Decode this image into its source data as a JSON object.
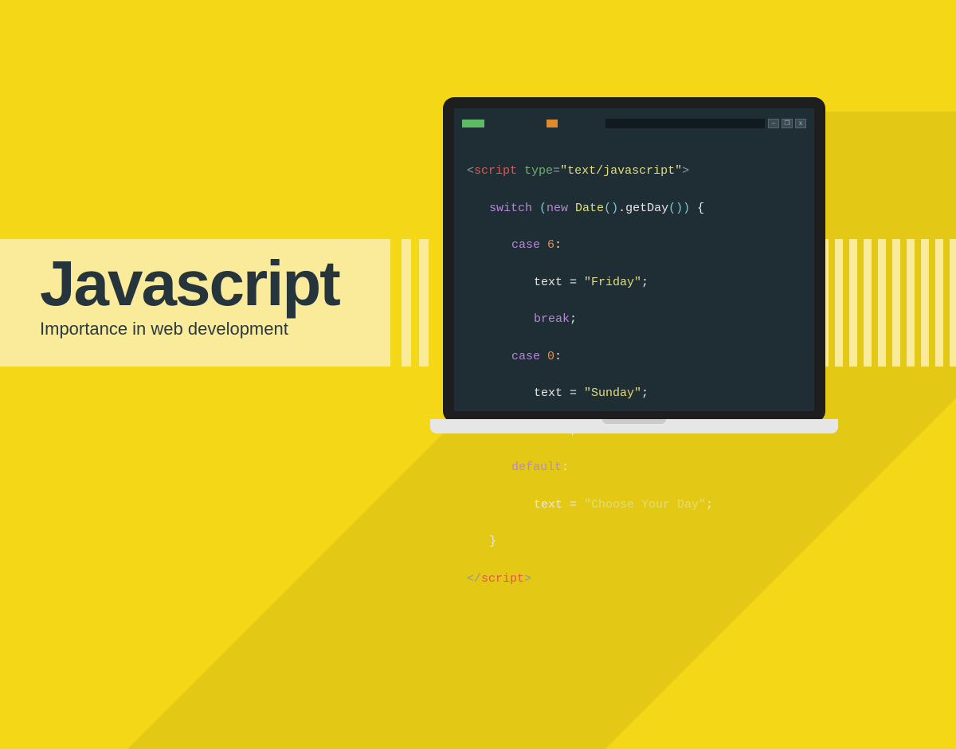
{
  "title": "Javascript",
  "subtitle": "Importance in web development",
  "window_icons": {
    "min": "–",
    "max": "❐",
    "close": "x"
  },
  "code": {
    "open_tag_l": "<",
    "open_tag_name": "script",
    "attr_name": " type",
    "eq": "=",
    "attr_val": "\"text/javascript\"",
    "open_tag_r": ">",
    "kw_switch": "switch ",
    "pl": "(",
    "kw_new": "new ",
    "cls_date": "Date",
    "pl2": "()",
    "dot": ".",
    "m_getday": "getDay",
    "pl3": "()",
    "pr": ")",
    "brace_l": " {",
    "kw_case1": "case ",
    "num6": "6",
    "colon": ":",
    "text_eq": "text = ",
    "str_fri": "\"Friday\"",
    "semi": ";",
    "kw_break": "break",
    "kw_case2": "case ",
    "num0": "0",
    "str_sun": "\"Sunday\"",
    "kw_default": "default",
    "str_choose": "\"Choose Your Day\"",
    "brace_r": "}",
    "close_tag_l": "</",
    "close_tag_r": ">"
  }
}
